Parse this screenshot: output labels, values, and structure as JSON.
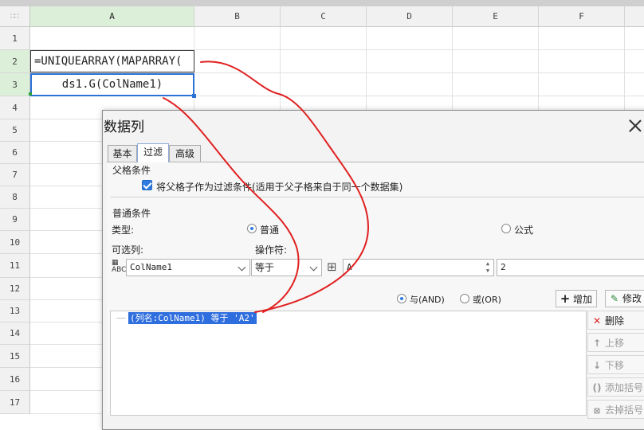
{
  "sheet": {
    "columns": [
      "A",
      "B",
      "C",
      "D",
      "E",
      "F"
    ],
    "rows": [
      "1",
      "2",
      "3",
      "4",
      "5",
      "6",
      "7",
      "8",
      "9",
      "10",
      "11",
      "12",
      "13",
      "14",
      "15",
      "16",
      "17"
    ],
    "cell_a2": "=UNIQUEARRAY(MAPARRAY(",
    "cell_a3": "ds1.G(ColName1)"
  },
  "dialog": {
    "title": "数据列",
    "tabs": [
      "基本",
      "过滤",
      "高级"
    ],
    "active_tab": "过滤",
    "parent_section": {
      "label": "父格条件",
      "checkbox_label": "将父格子作为过滤条件(适用于父子格来自于同一个数据集)",
      "checked": true
    },
    "normal_section": {
      "label": "普通条件",
      "type_label": "类型:",
      "type_options": [
        "普通",
        "公式"
      ],
      "type_selected": "普通",
      "column_label": "可选列:",
      "column_value": "ColName1",
      "operator_label": "操作符:",
      "operator_value": "等于",
      "value_text": "A",
      "second_value": "2"
    },
    "logic_options": [
      "与(AND)",
      "或(OR)"
    ],
    "logic_selected": "与(AND)",
    "add_button": "增加",
    "modify_button": "修改",
    "condition_item": "(列名:ColName1) 等于 'A2'",
    "side_buttons": [
      "删除",
      "上移",
      "下移",
      "添加括号",
      "去掉括号"
    ]
  },
  "colors": {
    "accent": "#2f6ede",
    "selection_header": "#dcefd8",
    "annotation": "#e02020"
  },
  "icons": [
    "checkbox-icon",
    "close-icon",
    "add-icon",
    "edit-icon",
    "delete-icon",
    "arrow-up-icon",
    "arrow-down-icon",
    "parenthesis-icon"
  ]
}
